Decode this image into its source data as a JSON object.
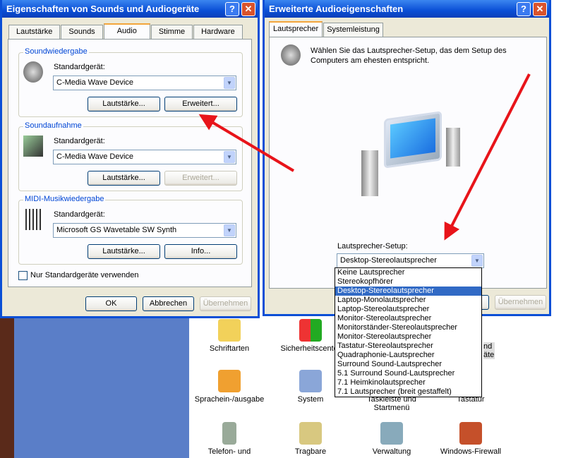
{
  "left_dialog": {
    "title": "Eigenschaften von Sounds und Audiogeräte",
    "help": "?",
    "close": "✕",
    "tabs": [
      "Lautstärke",
      "Sounds",
      "Audio",
      "Stimme",
      "Hardware"
    ],
    "active_tab": "Audio",
    "playback": {
      "legend": "Soundwiedergabe",
      "label": "Standardgerät:",
      "device": "C-Media Wave Device",
      "volume": "Lautstärke...",
      "advanced": "Erweitert..."
    },
    "recording": {
      "legend": "Soundaufnahme",
      "label": "Standardgerät:",
      "device": "C-Media Wave Device",
      "volume": "Lautstärke...",
      "advanced": "Erweitert..."
    },
    "midi": {
      "legend": "MIDI-Musikwiedergabe",
      "label": "Standardgerät:",
      "device": "Microsoft GS Wavetable SW Synth",
      "volume": "Lautstärke...",
      "info": "Info..."
    },
    "only_default": "Nur Standardgeräte verwenden",
    "ok": "OK",
    "cancel": "Abbrechen",
    "apply": "Übernehmen"
  },
  "right_dialog": {
    "title": "Erweiterte Audioeigenschaften",
    "help": "?",
    "close": "✕",
    "tabs": [
      "Lautsprecher",
      "Systemleistung"
    ],
    "active_tab": "Lautsprecher",
    "description": "Wählen Sie das Lautsprecher-Setup, das dem Setup des Computers am ehesten entspricht.",
    "setup_label": "Lautsprecher-Setup:",
    "setup_value": "Desktop-Stereolautsprecher",
    "apply": "Übernehmen",
    "options": [
      "Keine Lautsprecher",
      "Stereokopfhörer",
      "Desktop-Stereolautsprecher",
      "Laptop-Monolautsprecher",
      "Laptop-Stereolautsprecher",
      "Monitor-Stereolautsprecher",
      "Monitorständer-Stereolautsprecher",
      "Monitor-Stereolautsprecher",
      "Tastatur-Stereolautsprecher",
      "Quadraphonie-Lautsprecher",
      "Surround Sound-Lautsprecher",
      "5.1 Surround Sound-Lautsprecher",
      "7.1 Heimkinolautsprecher",
      "7.1 Lautsprecher (breit gestaffelt)"
    ],
    "selected_index": 2
  },
  "control_panel": {
    "items": [
      "Schriftarten",
      "Sicherheitscenter",
      "nd",
      "äte",
      "Sprachein-/ausgabe",
      "System",
      "Taskleiste und Startmenü",
      "Tastatur",
      "Telefon- und",
      "Tragbare",
      "Verwaltung",
      "Windows-Firewall"
    ]
  },
  "annotation_color": "#e8141a"
}
